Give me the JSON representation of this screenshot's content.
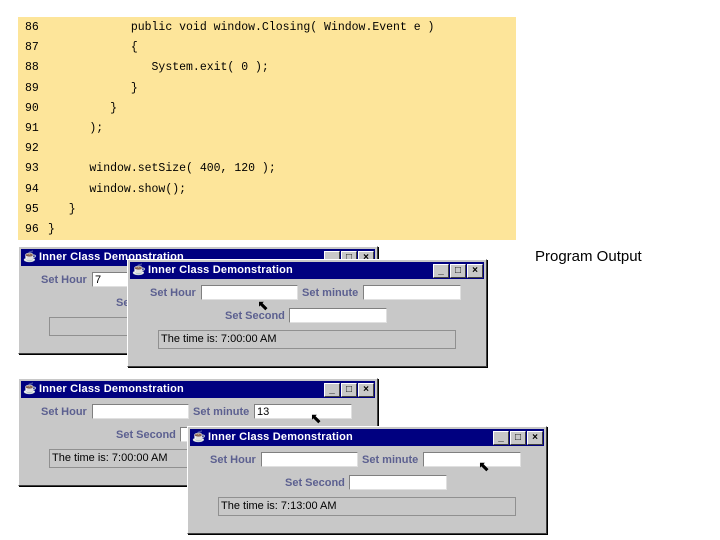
{
  "code_lines": [
    {
      "num": "86",
      "text": "            public void window.Closing( Window.Event e )"
    },
    {
      "num": "87",
      "text": "            {"
    },
    {
      "num": "88",
      "text": "               System.exit( 0 );"
    },
    {
      "num": "89",
      "text": "            }"
    },
    {
      "num": "90",
      "text": "         }"
    },
    {
      "num": "91",
      "text": "      );"
    },
    {
      "num": "92",
      "text": ""
    },
    {
      "num": "93",
      "text": "      window.setSize( 400, 120 );"
    },
    {
      "num": "94",
      "text": "      window.show();"
    },
    {
      "num": "95",
      "text": "   }"
    },
    {
      "num": "96",
      "text": "}"
    }
  ],
  "program_output_label": "Program Output",
  "windows": [
    {
      "title": "Inner Class Demonstration",
      "hour_label": "Set Hour",
      "hour_value": "7",
      "minute_label": "Set minute",
      "minute_value": "",
      "second_label": "Set Second",
      "second_value": "",
      "time_text": ""
    },
    {
      "title": "Inner Class Demonstration",
      "hour_label": "Set Hour",
      "hour_value": "",
      "minute_label": "Set minute",
      "minute_value": "",
      "second_label": "Set Second",
      "second_value": "",
      "time_text": "The time is: 7:00:00 AM"
    },
    {
      "title": "Inner Class Demonstration",
      "hour_label": "Set Hour",
      "hour_value": "",
      "minute_label": "Set minute",
      "minute_value": "13",
      "second_label": "Set Second",
      "second_value": "",
      "time_text": "The time is: 7:00:00 AM"
    },
    {
      "title": "Inner Class Demonstration",
      "hour_label": "Set Hour",
      "hour_value": "",
      "minute_label": "Set minute",
      "minute_value": "",
      "second_label": "Set Second",
      "second_value": "",
      "time_text": "The time is: 7:13:00 AM"
    }
  ],
  "window_buttons": {
    "minimize": "_",
    "maximize": "□",
    "close": "×"
  },
  "icons": {
    "app": "java-cup-icon",
    "cursor": "mouse-pointer-icon"
  },
  "colors": {
    "code_bg": "#fde59a",
    "titlebar": "#000080",
    "window_bg": "#c8c8c8",
    "label": "#5c6090"
  }
}
